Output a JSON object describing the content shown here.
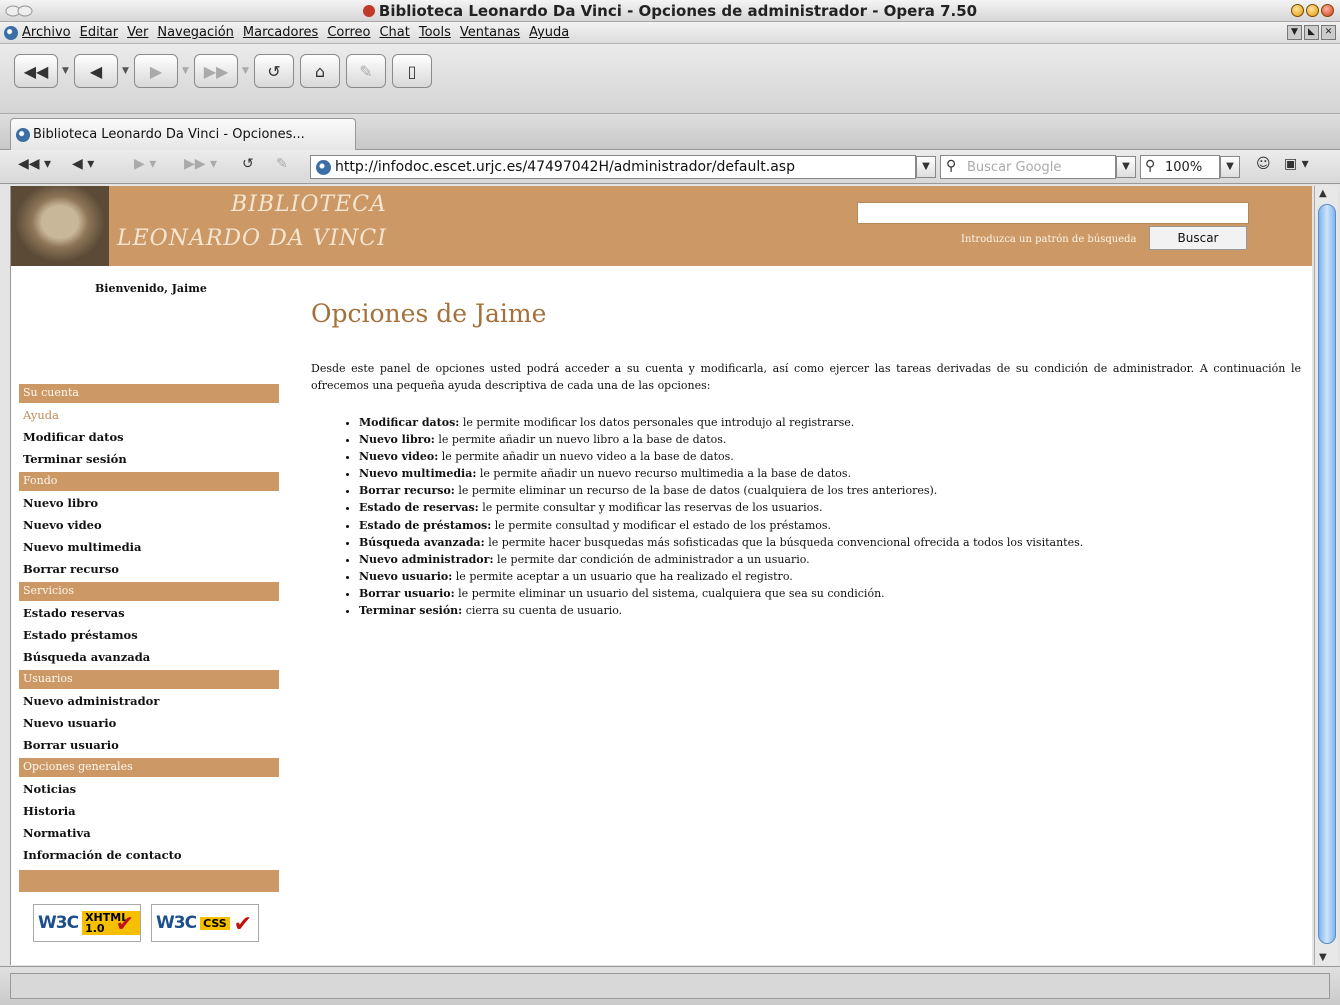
{
  "window": {
    "title": "Biblioteca Leonardo Da Vinci - Opciones de administrador - Opera 7.50"
  },
  "menu": [
    "Archivo",
    "Editar",
    "Ver",
    "Navegación",
    "Marcadores",
    "Correo",
    "Chat",
    "Tools",
    "Ventanas",
    "Ayuda"
  ],
  "tab": {
    "label": "Biblioteca Leonardo Da Vinci - Opciones..."
  },
  "address": {
    "url": "http://infodoc.escet.urjc.es/47497042H/administrador/default.asp",
    "search_placeholder": "Buscar Google",
    "zoom": "100%"
  },
  "site": {
    "brand_line1": "BIBLIOTECA",
    "brand_line2": "LEONARDO DA VINCI",
    "search_hint": "Introduzca un patrón de búsqueda",
    "search_button": "Buscar"
  },
  "sidebar": {
    "welcome": "Bienvenido, Jaime",
    "sections": [
      {
        "title": "Su cuenta",
        "items": [
          "Ayuda",
          "Modificar datos",
          "Terminar sesión"
        ]
      },
      {
        "title": "Fondo",
        "items": [
          "Nuevo libro",
          "Nuevo video",
          "Nuevo multimedia",
          "Borrar recurso"
        ]
      },
      {
        "title": "Servicios",
        "items": [
          "Estado reservas",
          "Estado préstamos",
          "Búsqueda avanzada"
        ]
      },
      {
        "title": "Usuarios",
        "items": [
          "Nuevo administrador",
          "Nuevo usuario",
          "Borrar usuario"
        ]
      },
      {
        "title": "Opciones generales",
        "items": [
          "Noticias",
          "Historia",
          "Normativa",
          "Información de contacto"
        ]
      }
    ],
    "current_item": "Ayuda",
    "badges": [
      {
        "logo": "W3C",
        "label": "XHTML 1.0"
      },
      {
        "logo": "W3C",
        "label": "CSS"
      }
    ]
  },
  "content": {
    "title": "Opciones de Jaime",
    "intro": "Desde este panel de opciones usted podrá acceder a su cuenta y modificarla, así como ejercer las tareas derivadas de su condición de administrador. A continuación le ofrecemos una pequeña ayuda descriptiva de cada una de las opciones:",
    "options": [
      {
        "name": "Modificar datos:",
        "desc": " le permite modificar los datos personales que introdujo al registrarse."
      },
      {
        "name": "Nuevo libro:",
        "desc": " le permite añadir un nuevo libro a la base de datos."
      },
      {
        "name": "Nuevo video:",
        "desc": " le permite añadir un nuevo video a la base de datos."
      },
      {
        "name": "Nuevo multimedia:",
        "desc": " le permite añadir un nuevo recurso multimedia a la base de datos."
      },
      {
        "name": "Borrar recurso:",
        "desc": " le permite eliminar un recurso de la base de datos (cualquiera de los tres anteriores)."
      },
      {
        "name": "Estado de reservas:",
        "desc": " le permite consultar y modificar las reservas de los usuarios."
      },
      {
        "name": "Estado de préstamos:",
        "desc": " le permite consultad y modificar el estado de los préstamos."
      },
      {
        "name": "Búsqueda avanzada:",
        "desc": " le permite hacer busquedas más sofisticadas que la búsqueda convencional ofrecida a todos los visitantes."
      },
      {
        "name": "Nuevo administrador:",
        "desc": " le permite dar condición de administrador a un usuario."
      },
      {
        "name": "Nuevo usuario:",
        "desc": " le permite aceptar a un usuario que ha realizado el registro."
      },
      {
        "name": "Borrar usuario:",
        "desc": " le permite eliminar un usuario del sistema, cualquiera que sea su condición."
      },
      {
        "name": "Terminar sesión:",
        "desc": " cierra su cuenta de usuario."
      }
    ]
  },
  "colors": {
    "accent": "#cc9966",
    "title": "#a5703a",
    "current_link": "#c08a55"
  }
}
